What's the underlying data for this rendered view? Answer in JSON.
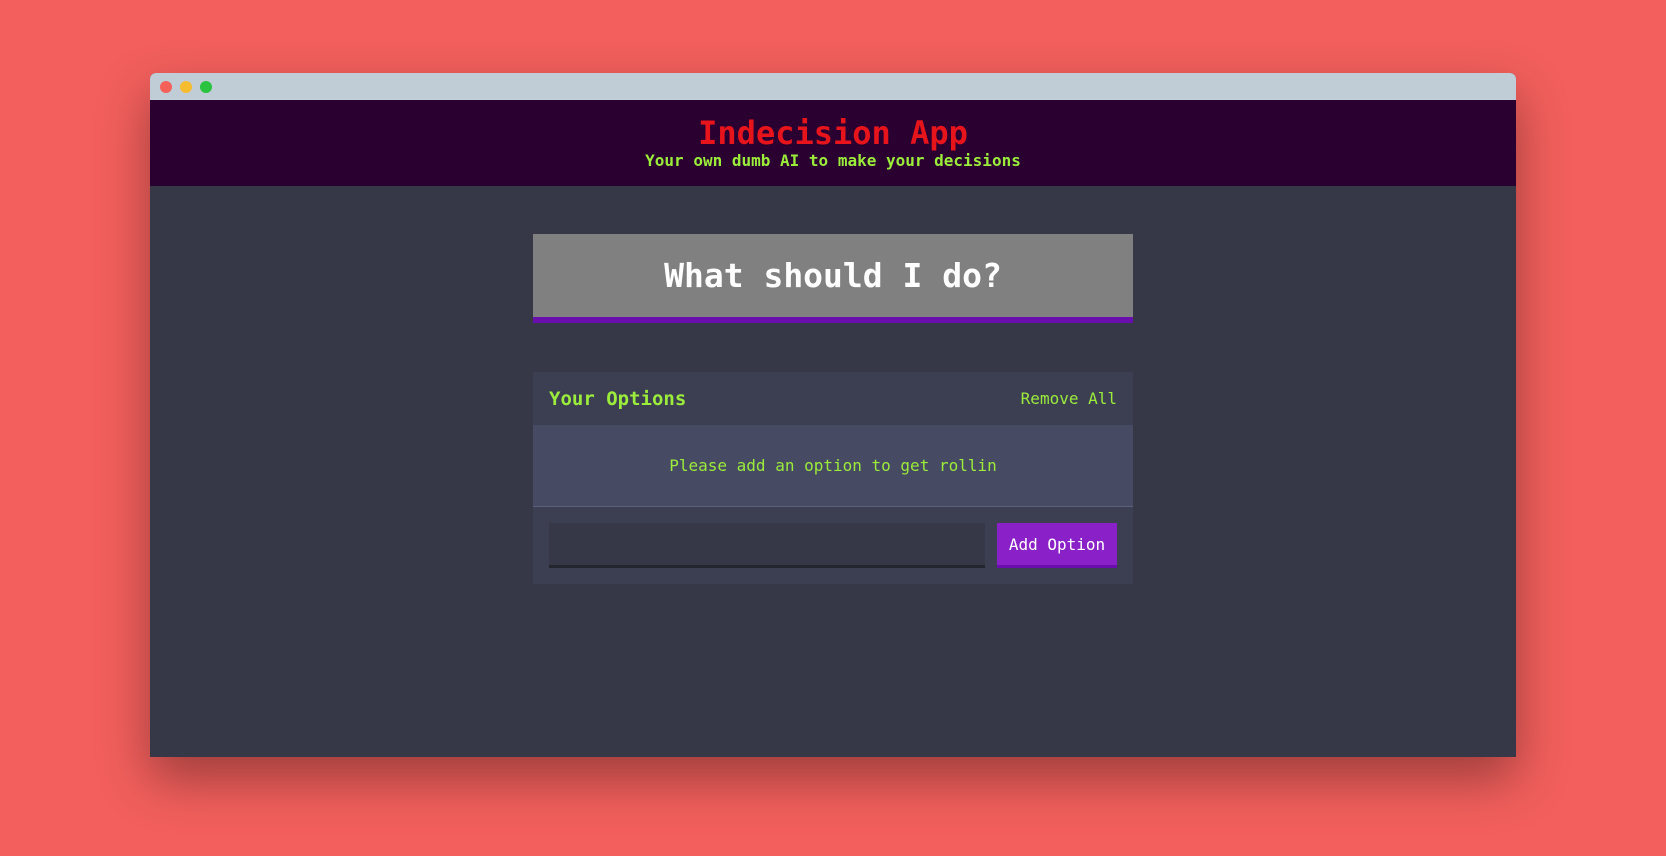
{
  "window": {
    "controls": [
      "close",
      "minimize",
      "maximize"
    ]
  },
  "header": {
    "title": "Indecision App",
    "subtitle": "Your own dumb AI to make your decisions"
  },
  "action": {
    "label": "What should I do?"
  },
  "options": {
    "title": "Your Options",
    "remove_all_label": "Remove All",
    "empty_message": "Please add an option to get rollin"
  },
  "add_option": {
    "input_value": "",
    "button_label": "Add Option"
  },
  "colors": {
    "page_background": "#f25f5c",
    "header_background": "#2a0030",
    "title": "#e8141c",
    "accent_text": "#9bec3b",
    "purple_accent": "#8a20c8",
    "body_background": "#363848"
  }
}
